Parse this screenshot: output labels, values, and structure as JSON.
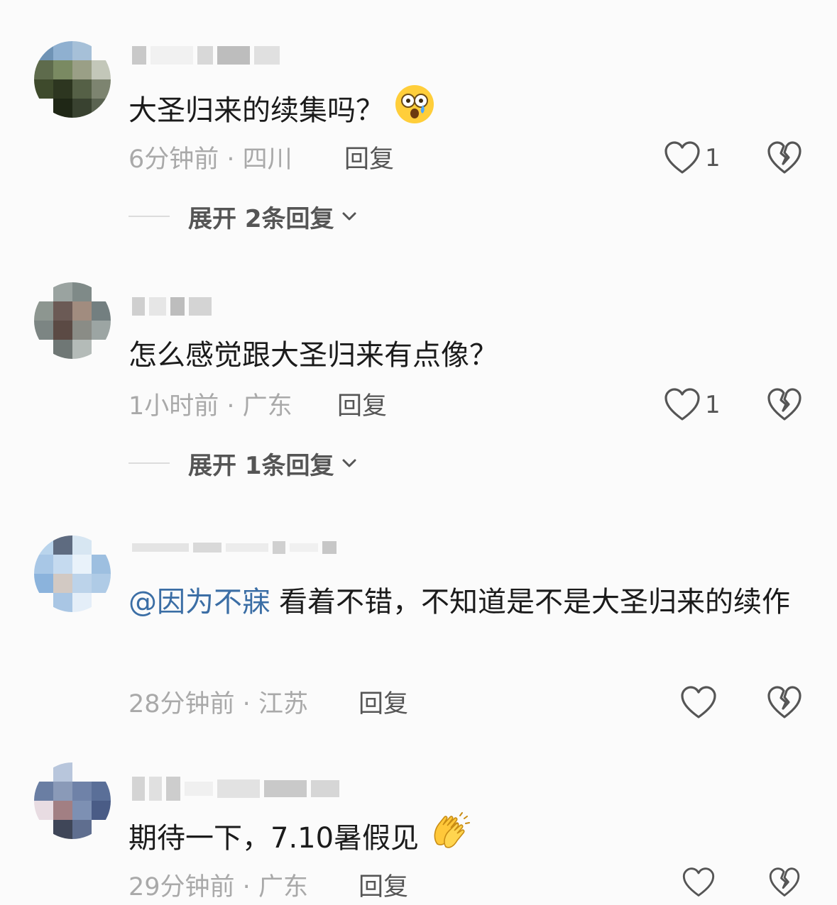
{
  "comments": [
    {
      "text": "大圣归来的续集吗？",
      "emoji": "astonished-emoji",
      "time": "6分钟前",
      "location": "四川",
      "reply_label": "回复",
      "likes": "1",
      "expand_label": "展开 2条回复"
    },
    {
      "text": "怎么感觉跟大圣归来有点像？",
      "time": "1小时前",
      "location": "广东",
      "reply_label": "回复",
      "likes": "1",
      "expand_label": "展开 1条回复"
    },
    {
      "mention": "@因为不寐",
      "text": "看着不错，不知道是不是大圣归来的续作",
      "time": "28分钟前",
      "location": "江苏",
      "reply_label": "回复",
      "likes": ""
    },
    {
      "text": "期待一下，7.10暑假见",
      "emoji": "clapping-hands-emoji",
      "time": "29分钟前",
      "location": "广东",
      "reply_label": "回复",
      "likes": ""
    }
  ],
  "meta_separator": " · ",
  "colors": {
    "meta": "#a9a9a9",
    "mention": "#3b6ea5",
    "action": "#555555"
  }
}
